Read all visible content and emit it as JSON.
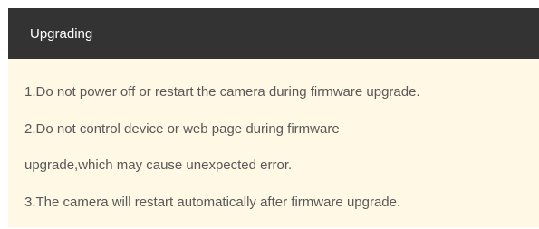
{
  "dialog": {
    "title": "Upgrading",
    "lines": [
      "1.Do not power off or restart the camera during firmware upgrade.",
      "2.Do not control device or web page during firmware",
      "upgrade,which may cause unexpected error.",
      "3.The camera will restart automatically after firmware upgrade."
    ]
  },
  "colors": {
    "header_background": "#333333",
    "header_text": "#ffffff",
    "body_background": "#fff8e5",
    "body_text": "#595959"
  }
}
